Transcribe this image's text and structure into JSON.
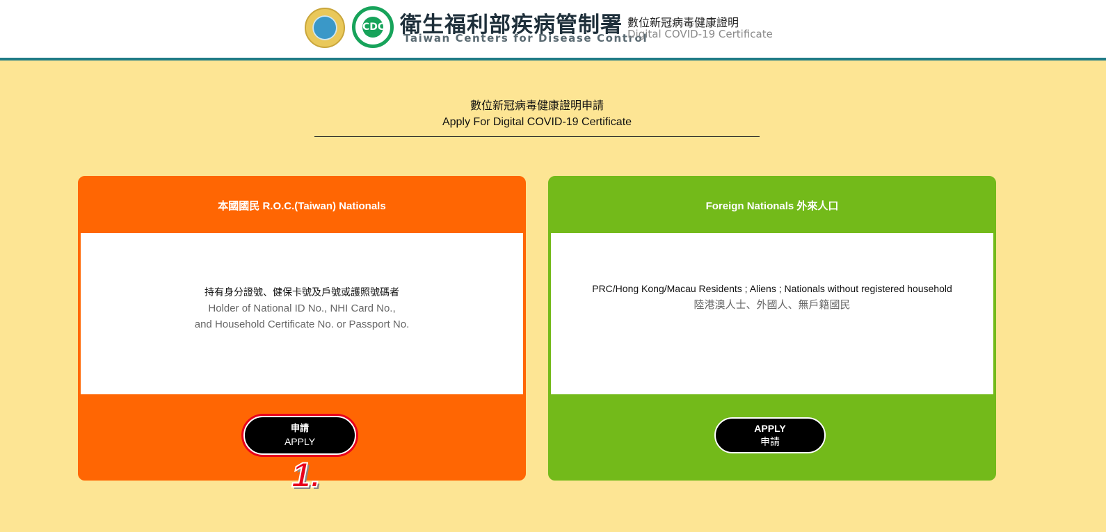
{
  "header": {
    "agency_name_zh": "衛生福利部疾病管制署",
    "agency_name_en": "Taiwan Centers for Disease Control",
    "cdc_logo_text": "CDC",
    "site_title_zh": "數位新冠病毒健康證明",
    "site_title_en": "Digital COVID-19 Certificate"
  },
  "main": {
    "heading_zh": "數位新冠病毒健康證明申請",
    "heading_en": "Apply For Digital COVID-19 Certificate"
  },
  "cards": [
    {
      "title": "本國國民 R.O.C.(Taiwan) Nationals",
      "body_line1": "持有身分證號、健保卡號及戶號或護照號碼者",
      "body_line2": "Holder of National ID No., NHI Card No.,",
      "body_line3": "and Household Certificate No. or Passport No.",
      "button_line1": "申請",
      "button_line2": "APPLY",
      "color": "#ff6603"
    },
    {
      "title": "Foreign Nationals 外來人口",
      "body_line1": "PRC/Hong Kong/Macau Residents ; Aliens ; Nationals without registered household",
      "body_line2": "陸港澳人士、外國人、無戶籍國民",
      "button_line1": "APPLY",
      "button_line2": "申請",
      "color": "#73ba1a"
    }
  ],
  "annotation": {
    "step_label": "1.",
    "color": "#e8001c"
  }
}
